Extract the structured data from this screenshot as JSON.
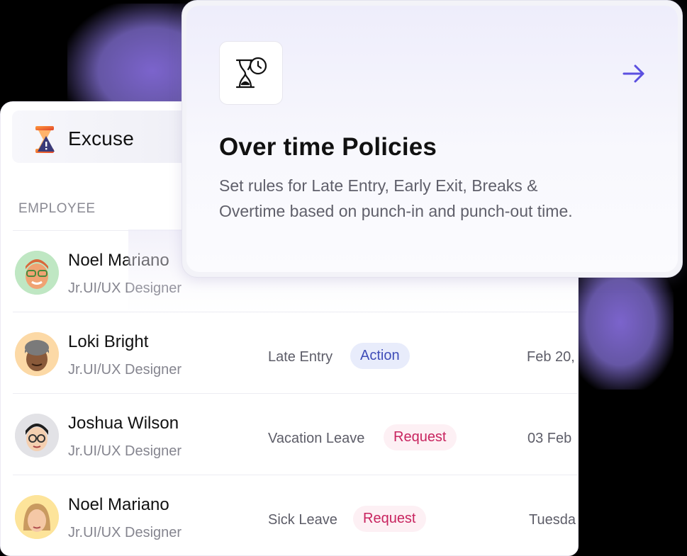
{
  "excuse": {
    "title": "Excuse",
    "column_employee": "EMPLOYEE",
    "rows": [
      {
        "name": "Noel Mariano",
        "role": "Jr.UI/UX Designer",
        "type": "",
        "badge": "",
        "date": ""
      },
      {
        "name": "Loki Bright",
        "role": "Jr.UI/UX Designer",
        "type": "Late Entry",
        "badge": "Action",
        "date": "Feb 20,"
      },
      {
        "name": "Joshua Wilson",
        "role": "Jr.UI/UX Designer",
        "type": "Vacation Leave",
        "badge": "Request",
        "date": "03 Feb"
      },
      {
        "name": "Noel Mariano",
        "role": "Jr.UI/UX Designer",
        "type": "Sick Leave",
        "badge": "Request",
        "date": "Tuesda"
      }
    ]
  },
  "policy": {
    "title": "Over time Policies",
    "description": "Set rules for Late Entry, Early Exit, Breaks & Overtime based on punch-in and punch-out time.",
    "icon": "hourglass-clock-icon",
    "arrow_icon": "arrow-right-icon"
  },
  "colors": {
    "accent": "#5b4fe0",
    "action_badge_bg": "#e8ecfb",
    "action_badge_text": "#3f4db8",
    "request_badge_bg": "#fdf0f4",
    "request_badge_text": "#c8245f",
    "glow": "#8a6fd8"
  }
}
